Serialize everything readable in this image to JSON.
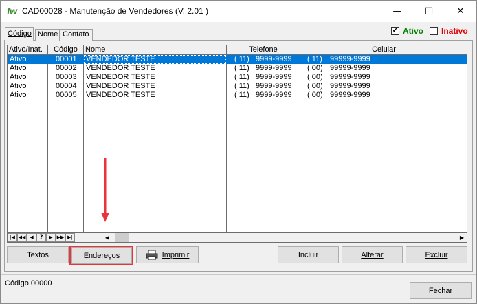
{
  "window": {
    "icon_text": "fw",
    "title": "CAD00028 - Manutenção de Vendedores  (V.  2.01 )",
    "minimize_glyph": "—",
    "maximize_glyph": "☐",
    "close_glyph": "✕"
  },
  "tabs": [
    {
      "label": "Código",
      "active": true
    },
    {
      "label": "Nome",
      "active": false
    },
    {
      "label": "Contato",
      "active": false
    }
  ],
  "filters": {
    "ativo_label": "Ativo",
    "ativo_checked": true,
    "ativo_color": "#008000",
    "inativo_label": "Inativo",
    "inativo_checked": false,
    "inativo_color": "#e00000"
  },
  "grid": {
    "columns": [
      "Ativo/Inat.",
      "Código",
      "Nome",
      "Telefone",
      "Celular"
    ],
    "rows": [
      {
        "ativo": "Ativo",
        "codigo": "00001",
        "nome": "VENDEDOR TESTE",
        "tel_ddd": "( 11)",
        "tel": "9999-9999",
        "cel_ddd": "( 11)",
        "cel": "99999-9999"
      },
      {
        "ativo": "Ativo",
        "codigo": "00002",
        "nome": "VENDEDOR TESTE",
        "tel_ddd": "( 11)",
        "tel": "9999-9999",
        "cel_ddd": "( 00)",
        "cel": "99999-9999"
      },
      {
        "ativo": "Ativo",
        "codigo": "00003",
        "nome": "VENDEDOR TESTE",
        "tel_ddd": "( 11)",
        "tel": "9999-9999",
        "cel_ddd": "( 00)",
        "cel": "99999-9999"
      },
      {
        "ativo": "Ativo",
        "codigo": "00004",
        "nome": "VENDEDOR TESTE",
        "tel_ddd": "( 11)",
        "tel": "9999-9999",
        "cel_ddd": "( 00)",
        "cel": "99999-9999"
      },
      {
        "ativo": "Ativo",
        "codigo": "00005",
        "nome": "VENDEDOR TESTE",
        "tel_ddd": "( 11)",
        "tel": "9999-9999",
        "cel_ddd": "( 00)",
        "cel": "99999-9999"
      }
    ],
    "selected_row": 0,
    "selection_color": "#0078d7"
  },
  "navigator": {
    "first": "|◀",
    "prev_page": "◀◀",
    "prev": "◀",
    "search": "?",
    "next": "▶",
    "next_page": "▶▶",
    "last": "▶|"
  },
  "scroll": {
    "left": "◀",
    "right": "▶"
  },
  "buttons": {
    "textos": "Textos",
    "enderecos": "Endereços",
    "imprimir": "Imprimir",
    "incluir": "Incluir",
    "alterar": "Alterar",
    "excluir": "Excluir",
    "fechar": "Fechar"
  },
  "annotation": {
    "color": "#e8343a"
  },
  "status": {
    "text": "Código 00000"
  }
}
